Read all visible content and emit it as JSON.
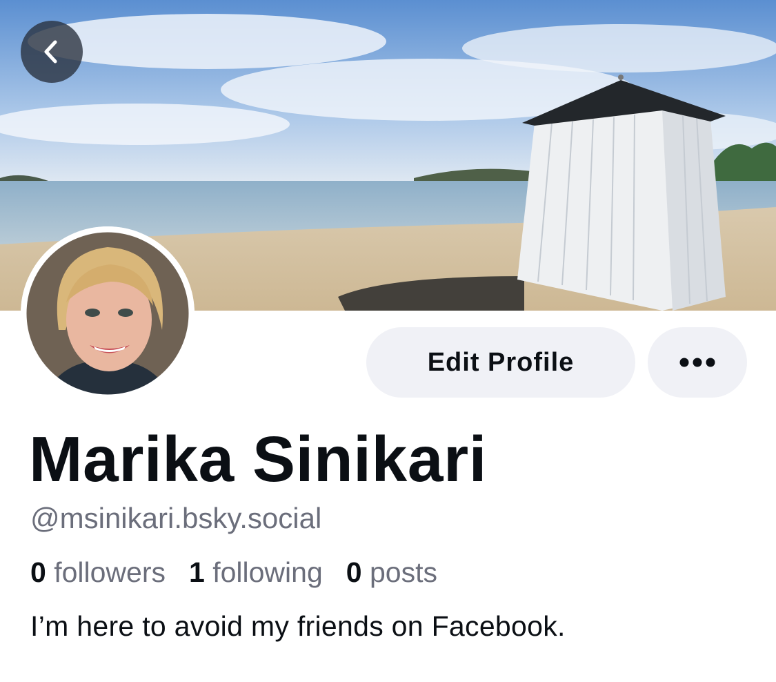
{
  "profile": {
    "display_name": "Marika Sinikari",
    "handle": "@msinikari.bsky.social",
    "bio": "I’m here to avoid my friends on Facebook.",
    "stats": {
      "followers_count": "0",
      "followers_label": "followers",
      "following_count": "1",
      "following_label": "following",
      "posts_count": "0",
      "posts_label": "posts"
    }
  },
  "actions": {
    "edit_label": "Edit Profile",
    "more_icon": "ellipsis-icon",
    "back_icon": "chevron-left-icon"
  },
  "colors": {
    "button_bg": "#f0f1f6",
    "text_primary": "#0b0f14",
    "text_secondary": "#6b6e7b"
  }
}
